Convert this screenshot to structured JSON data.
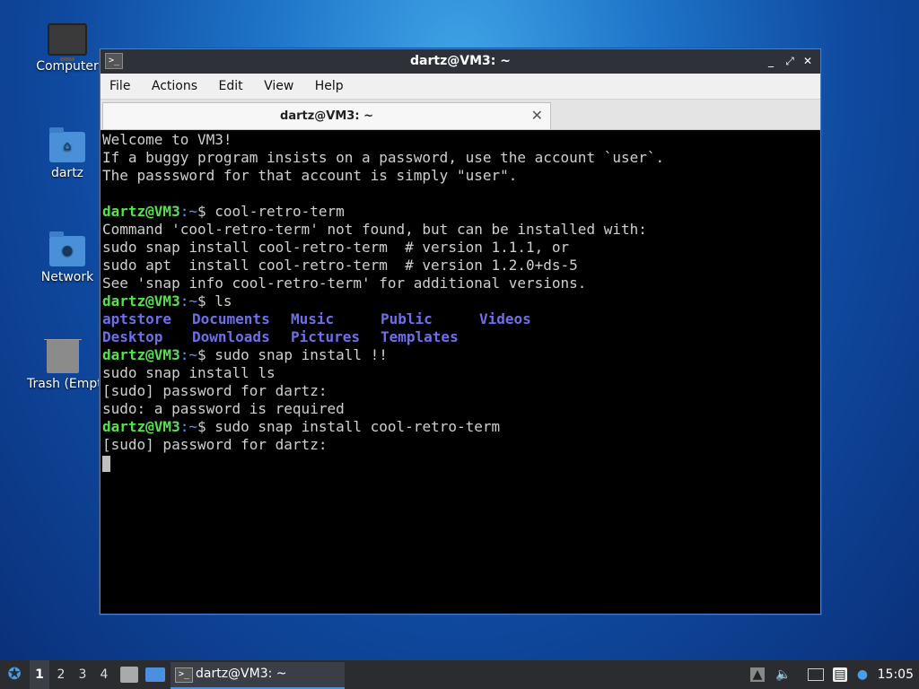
{
  "desktop": {
    "icons": [
      {
        "label": "Computer",
        "icon": "computer-icon"
      },
      {
        "label": "dartz",
        "icon": "home-folder-icon"
      },
      {
        "label": "Network",
        "icon": "network-folder-icon"
      },
      {
        "label": "Trash (Empty)",
        "icon": "trash-icon"
      }
    ]
  },
  "window": {
    "title": "dartz@VM3: ~",
    "controls": {
      "minimize": "_",
      "maximize": "⤢",
      "close": "✕"
    },
    "menu": [
      "File",
      "Actions",
      "Edit",
      "View",
      "Help"
    ],
    "tab": {
      "label": "dartz@VM3: ~",
      "close": "✕"
    },
    "prompt": {
      "user": "dartz@VM3",
      "path": ":~",
      "sign": "$"
    }
  },
  "terminal": {
    "lines": [
      "Welcome to VM3!",
      "If a buggy program insists on a password, use the account `user`.",
      "The passsword for that account is simply \"user\".",
      "",
      "cool-retro-term",
      "Command 'cool-retro-term' not found, but can be installed with:",
      "sudo snap install cool-retro-term  # version 1.1.1, or",
      "sudo apt  install cool-retro-term  # version 1.2.0+ds-5",
      "See 'snap info cool-retro-term' for additional versions.",
      "ls",
      "",
      "",
      "sudo snap install !!",
      "sudo snap install ls",
      "[sudo] password for dartz:",
      "sudo: a password is required",
      "sudo snap install cool-retro-term",
      "[sudo] password for dartz:"
    ],
    "ls_output": {
      "row1": [
        "aptstore",
        "Documents",
        "Music",
        "Public",
        "Videos"
      ],
      "row2": [
        "Desktop",
        "Downloads",
        "Pictures",
        "Templates"
      ]
    }
  },
  "taskbar": {
    "workspaces": [
      "1",
      "2",
      "3",
      "4"
    ],
    "active_workspace": "1",
    "task": {
      "label": "dartz@VM3: ~"
    },
    "clock": "15:05",
    "colors": {
      "accent": "#4a8fe0"
    }
  }
}
